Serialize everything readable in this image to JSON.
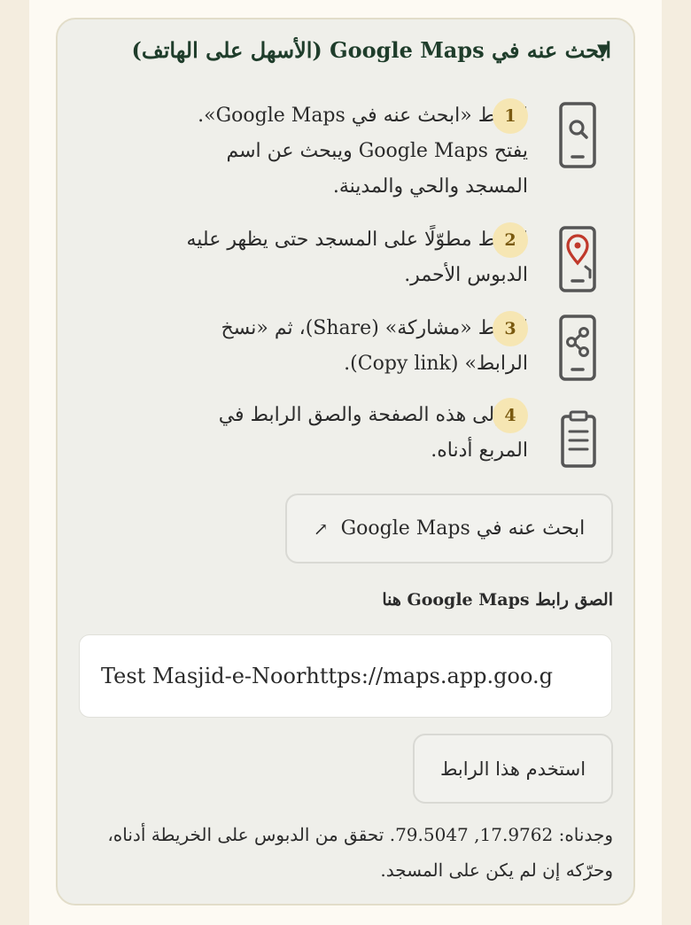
{
  "section": {
    "title": "ابحث عنه في Google Maps (الأسهل على الهاتف)",
    "toggle_icon": "triangle-down-icon"
  },
  "steps": [
    {
      "number": "1",
      "text": "اضغط «ابحث عنه في Google Maps». يفتح Google Maps ويبحث عن اسم المسجد والحي والمدينة.",
      "icon": "phone-search-icon"
    },
    {
      "number": "2",
      "text": "اضغط مطوّلًا على المسجد حتى يظهر عليه الدبوس الأحمر.",
      "icon": "phone-pin-icon"
    },
    {
      "number": "3",
      "text": "اضغط «مشاركة» (Share)، ثم «نسخ الرابط» (Copy link).",
      "icon": "phone-share-icon"
    },
    {
      "number": "4",
      "text": "عُد إلى هذه الصفحة والصق الرابط في المربع أدناه.",
      "icon": "clipboard-icon"
    }
  ],
  "maps_button": {
    "label": "ابحث عنه في Google Maps",
    "icon": "external-link-icon",
    "glyph": "↗"
  },
  "paste": {
    "label": "الصق رابط Google Maps هنا",
    "value": "Test Masjid-e-Noorhttps://maps.app.goo.g"
  },
  "use_button": {
    "label": "استخدم هذا الرابط"
  },
  "found_message": "وجدناه: 17.9762, 79.5047. تحقق من الدبوس على الخريطة أدناه، وحرّكه إن لم يكن على المسجد.",
  "colors": {
    "card_bg": "#efefea",
    "heading": "#1f3d2b",
    "badge_bg": "#f6e6b3",
    "badge_text": "#7a5a10",
    "pin_red": "#c0392b",
    "icon_gray": "#555555"
  }
}
